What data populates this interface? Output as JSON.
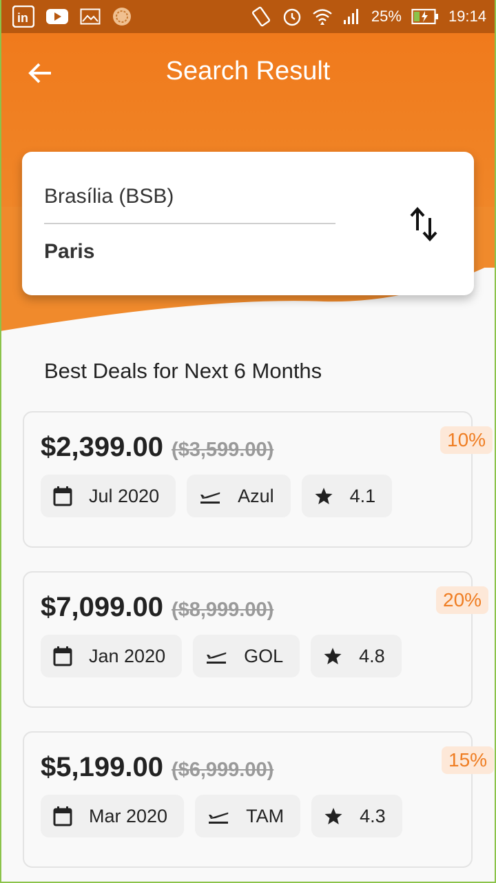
{
  "status_bar": {
    "battery": "25%",
    "time": "19:14"
  },
  "header": {
    "title": "Search Result"
  },
  "route": {
    "from": "Brasília (BSB)",
    "to": "Paris"
  },
  "section_title": "Best Deals for Next 6 Months",
  "deals": [
    {
      "price": "$2,399.00",
      "old_price": "($3,599.00)",
      "discount": "10%",
      "date": "Jul 2020",
      "airline": "Azul",
      "rating": "4.1"
    },
    {
      "price": "$7,099.00",
      "old_price": "($8,999.00)",
      "discount": "20%",
      "date": "Jan 2020",
      "airline": "GOL",
      "rating": "4.8"
    },
    {
      "price": "$5,199.00",
      "old_price": "($6,999.00)",
      "discount": "15%",
      "date": "Mar 2020",
      "airline": "TAM",
      "rating": "4.3"
    }
  ],
  "colors": {
    "accent": "#f07a1c",
    "discount_bg": "#fde8d8",
    "status_bar": "#b8580f"
  }
}
